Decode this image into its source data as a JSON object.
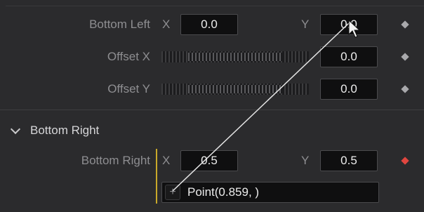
{
  "bottom_left": {
    "label": "Bottom Left",
    "x_axis": "X",
    "x_value": "0.0",
    "y_axis": "Y",
    "y_value": "0.0"
  },
  "offset_x": {
    "label": "Offset X",
    "value": "0.0"
  },
  "offset_y": {
    "label": "Offset Y",
    "value": "0.0"
  },
  "section": {
    "title": "Bottom Right"
  },
  "bottom_right": {
    "label": "Bottom Right",
    "x_axis": "X",
    "x_value": "0.5",
    "y_axis": "Y",
    "y_value": "0.5"
  },
  "expression": {
    "text": "Point(0.859, )",
    "pick_glyph": "+"
  },
  "colors": {
    "keyframe_default": "#a9a9ac",
    "keyframe_active": "#e0463f",
    "link_line": "#c9a92a"
  }
}
